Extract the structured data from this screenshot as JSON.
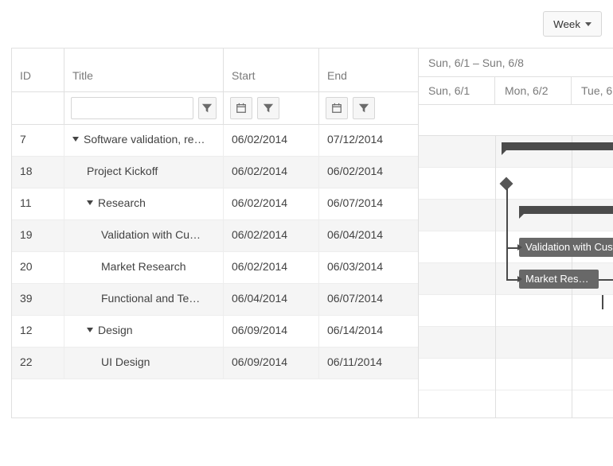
{
  "toolbar": {
    "view_label": "Week"
  },
  "columns": {
    "id": "ID",
    "title": "Title",
    "start": "Start",
    "end": "End"
  },
  "filters": {
    "title_value": ""
  },
  "timeline": {
    "range_label": "Sun, 6/1 – Sun, 6/8",
    "days": [
      "Sun, 6/1",
      "Mon, 6/2",
      "Tue, 6"
    ]
  },
  "rows": [
    {
      "id": "7",
      "title": "Software validation, re…",
      "start": "06/02/2014",
      "end": "07/12/2014",
      "level": 0,
      "expandable": true,
      "kind": "summary"
    },
    {
      "id": "18",
      "title": "Project Kickoff",
      "start": "06/02/2014",
      "end": "06/02/2014",
      "level": 1,
      "expandable": false,
      "kind": "milestone"
    },
    {
      "id": "11",
      "title": "Research",
      "start": "06/02/2014",
      "end": "06/07/2014",
      "level": 1,
      "expandable": true,
      "kind": "summary"
    },
    {
      "id": "19",
      "title": "Validation with Cu…",
      "start": "06/02/2014",
      "end": "06/04/2014",
      "level": 2,
      "expandable": false,
      "kind": "task",
      "bar_label": "Validation with Cust"
    },
    {
      "id": "20",
      "title": "Market Research",
      "start": "06/02/2014",
      "end": "06/03/2014",
      "level": 2,
      "expandable": false,
      "kind": "task",
      "bar_label": "Market Rese…"
    },
    {
      "id": "39",
      "title": "Functional and Te…",
      "start": "06/04/2014",
      "end": "06/07/2014",
      "level": 2,
      "expandable": false,
      "kind": "task"
    },
    {
      "id": "12",
      "title": "Design",
      "start": "06/09/2014",
      "end": "06/14/2014",
      "level": 1,
      "expandable": true,
      "kind": "summary_offscreen"
    },
    {
      "id": "22",
      "title": "UI Design",
      "start": "06/09/2014",
      "end": "06/11/2014",
      "level": 2,
      "expandable": false,
      "kind": "task_offscreen"
    }
  ]
}
